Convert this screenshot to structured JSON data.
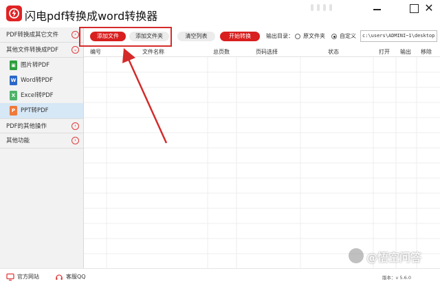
{
  "window": {
    "title": "闪电pdf转换成word转换器",
    "colors": {
      "brand": "#e02323",
      "accent_button": "#d91f1f",
      "active_row": "#d6e7f6"
    }
  },
  "sidebar": {
    "categories": [
      {
        "label": "PDF转换成其它文件",
        "icon": "chevron-right-circle-icon"
      },
      {
        "label": "其他文件转换成PDF",
        "icon": "chevron-down-circle-icon"
      },
      {
        "label": "PDF的其他操作",
        "icon": "chevron-right-circle-icon"
      },
      {
        "label": "其他功能",
        "icon": "chevron-right-circle-icon"
      }
    ],
    "items": [
      {
        "label": "图片转PDF",
        "icon": "image-file-icon",
        "color": "#2e9e3e",
        "glyph": "▣"
      },
      {
        "label": "Word转PDF",
        "icon": "word-file-icon",
        "color": "#2b67c9",
        "glyph": "W"
      },
      {
        "label": "Excel转PDF",
        "icon": "excel-file-icon",
        "color": "#4db36a",
        "glyph": "X"
      },
      {
        "label": "PPT转PDF",
        "icon": "ppt-file-icon",
        "color": "#ef7a3a",
        "glyph": "P"
      }
    ],
    "active_item": "PPT转PDF"
  },
  "toolbar": {
    "add_file": "添加文件",
    "add_folder": "添加文件夹",
    "clear_list": "清空列表",
    "start_convert": "开始转换",
    "output_dir_label": "输出目录：",
    "option_original": "原文件夹",
    "option_custom": "自定义",
    "selected_option": "自定义",
    "path_value": "c:\\users\\ADMINI~1\\desktop"
  },
  "table": {
    "columns": [
      "编号",
      "文件名称",
      "总页数",
      "页码选择",
      "状态",
      "打开",
      "输出",
      "移除"
    ]
  },
  "footer": {
    "website": "官方网站",
    "qq_support": "客服QQ",
    "version": "版本：v 5.6.0"
  },
  "watermark": {
    "text": "@悟空问答"
  }
}
